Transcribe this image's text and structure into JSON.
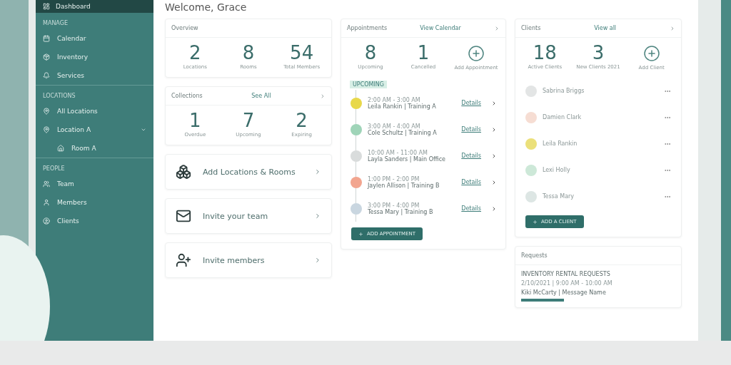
{
  "sidebar": {
    "active": {
      "label": "Dashboard",
      "selected": true
    },
    "sections": [
      {
        "title": "MANAGE",
        "items": [
          {
            "label": "Calendar"
          },
          {
            "label": "Inventory"
          },
          {
            "label": "Services"
          }
        ]
      },
      {
        "title": "LOCATIONS",
        "items": [
          {
            "label": "All Locations"
          },
          {
            "label": "Location A",
            "expanded": true,
            "children": [
              {
                "label": "Room A"
              }
            ]
          }
        ]
      },
      {
        "title": "PEOPLE",
        "items": [
          {
            "label": "Team"
          },
          {
            "label": "Members"
          },
          {
            "label": "Clients"
          }
        ]
      }
    ]
  },
  "welcome": "Welcome, Grace",
  "overview": {
    "title": "Overview",
    "stats": [
      {
        "value": "2",
        "label": "Locations"
      },
      {
        "value": "8",
        "label": "Rooms"
      },
      {
        "value": "54",
        "label": "Total Members"
      }
    ]
  },
  "collections": {
    "title": "Collections",
    "link": "See All",
    "stats": [
      {
        "value": "1",
        "label": "Overdue"
      },
      {
        "value": "7",
        "label": "Upcoming"
      },
      {
        "value": "2",
        "label": "Expiring"
      }
    ]
  },
  "actions": [
    {
      "label": "Add Locations & Rooms"
    },
    {
      "label": "Invite your team"
    },
    {
      "label": "Invite members"
    }
  ],
  "appointments": {
    "title": "Appointments",
    "link": "View Calendar",
    "stats": [
      {
        "value": "8",
        "label": "Upcoming"
      },
      {
        "value": "1",
        "label": "Cancelled"
      }
    ],
    "add_label": "Add Appointment",
    "badge": "UPCOMING",
    "items": [
      {
        "time": "2:00 AM - 3:00 AM",
        "text": "Leila Rankin | Training A",
        "link": "Details",
        "color": "#e8d84a"
      },
      {
        "time": "3:00 AM - 4:00 AM",
        "text": "Cole Schultz | Training A",
        "link": "Details",
        "color": "#9fd4b8"
      },
      {
        "time": "10:00 AM - 11:00 AM",
        "text": "Layla Sanders | Main Office",
        "link": "Details",
        "color": "#d9dcdc"
      },
      {
        "time": "1:00 PM - 2:00 PM",
        "text": "Jaylen Allison | Training B",
        "link": "Details",
        "color": "#f2a58f"
      },
      {
        "time": "3:00 PM - 4:00 PM",
        "text": "Tessa Mary | Training B",
        "link": "Details",
        "color": "#c9d6e0"
      }
    ],
    "button": "ADD APPOINTMENT"
  },
  "clients": {
    "title": "Clients",
    "link": "View all",
    "stats": [
      {
        "value": "18",
        "label": "Active Clients"
      },
      {
        "value": "3",
        "label": "New Clients 2021"
      }
    ],
    "add_label": "Add Client",
    "items": [
      {
        "name": "Sabrina Briggs",
        "color": "#e3e5e5"
      },
      {
        "name": "Damien Clark",
        "color": "#f6ddd3"
      },
      {
        "name": "Leila Rankin",
        "color": "#ebe07a"
      },
      {
        "name": "Lexi Holly",
        "color": "#cde8d8"
      },
      {
        "name": "Tessa Mary",
        "color": "#dde6e4"
      }
    ],
    "button": "ADD A CLIENT"
  },
  "requests": {
    "title": "Requests",
    "heading": "INVENTORY RENTAL REQUESTS",
    "meta": "2/10/2021 | 9:00 AM - 10:00 AM",
    "text": "Kiki McCarty | Message Name"
  }
}
